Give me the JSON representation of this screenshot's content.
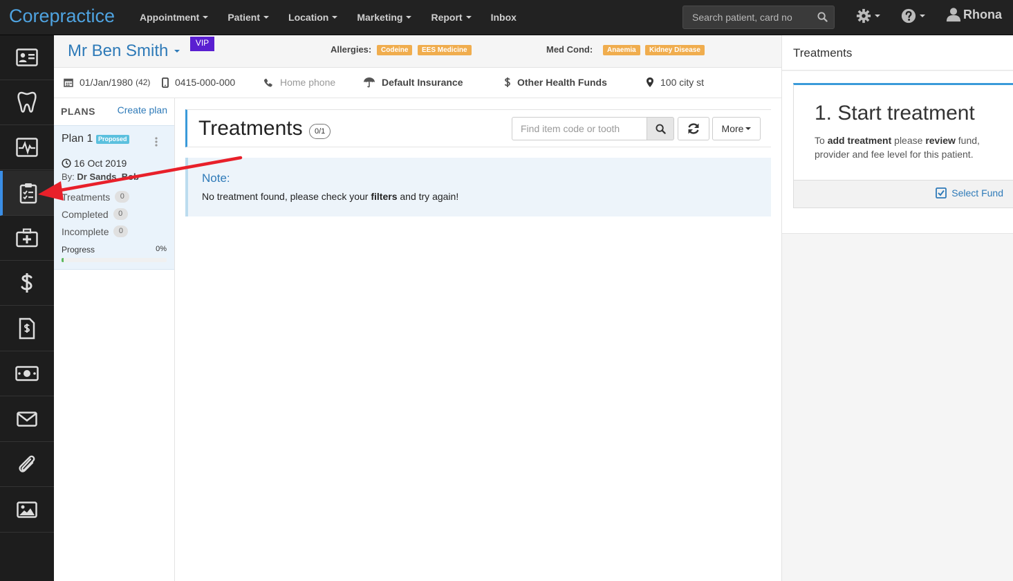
{
  "app": {
    "brand": "Corepractice"
  },
  "nav": {
    "items": [
      {
        "label": "Appointment",
        "dropdown": true
      },
      {
        "label": "Patient",
        "dropdown": true
      },
      {
        "label": "Location",
        "dropdown": true
      },
      {
        "label": "Marketing",
        "dropdown": true
      },
      {
        "label": "Report",
        "dropdown": true
      },
      {
        "label": "Inbox",
        "dropdown": false
      }
    ],
    "search_placeholder": "Search patient, card no",
    "user": "Rhona"
  },
  "sidebar": {
    "items": [
      {
        "icon": "id-card-icon"
      },
      {
        "icon": "tooth-icon"
      },
      {
        "icon": "heartbeat-monitor-icon"
      },
      {
        "icon": "clipboard-checklist-icon",
        "active": true
      },
      {
        "icon": "medical-kit-icon"
      },
      {
        "icon": "dollar-icon"
      },
      {
        "icon": "invoice-icon"
      },
      {
        "icon": "cash-icon"
      },
      {
        "icon": "envelope-icon"
      },
      {
        "icon": "paperclip-icon"
      },
      {
        "icon": "image-icon"
      }
    ]
  },
  "patient": {
    "name": "Mr Ben Smith",
    "vip": "VIP",
    "allergies_label": "Allergies:",
    "allergies": [
      "Codeine",
      "EES Medicine"
    ],
    "medcond_label": "Med Cond:",
    "med_conditions": [
      "Anaemia",
      "Kidney Disease"
    ],
    "dob": "01/Jan/1980",
    "age": "(42)",
    "mobile": "0415-000-000",
    "home_phone": "Home phone",
    "insurance": "Default Insurance",
    "health_funds": "Other Health Funds",
    "address": "100 city st"
  },
  "plans": {
    "title": "PLANS",
    "create_label": "Create plan",
    "plan": {
      "name": "Plan 1",
      "status": "Proposed",
      "date": "16 Oct 2019",
      "by_label": "By:",
      "by": "Dr Sands, Bob",
      "stats": [
        {
          "label": "Treatments",
          "count": "0"
        },
        {
          "label": "Completed",
          "count": "0"
        },
        {
          "label": "Incomplete",
          "count": "0"
        }
      ],
      "progress_label": "Progress",
      "progress_pct": "0%",
      "progress_value": 0
    }
  },
  "treatments": {
    "title": "Treatments",
    "count": "0/1",
    "find_placeholder": "Find item code or tooth",
    "more_label": "More",
    "note_title": "Note:",
    "note_prefix": "No treatment found, please check your ",
    "note_bold": "filters",
    "note_suffix": " and try again!"
  },
  "right_panel": {
    "title": "Treatments",
    "step_title": "1. Start treatment",
    "text_1": "To ",
    "text_bold_1": "add treatment",
    "text_2": " please ",
    "text_bold_2": "review",
    "text_3": " fund, provider and fee level for this patient.",
    "select_fund": "Select Fund"
  },
  "colors": {
    "navbar": "#222222",
    "brand": "#4fa3e0",
    "link": "#2e7ab8",
    "vip": "#5a1fd1",
    "tag_orange": "#f0ad4e",
    "accent": "#3a9ad9",
    "annotation_arrow": "#e8202a"
  }
}
